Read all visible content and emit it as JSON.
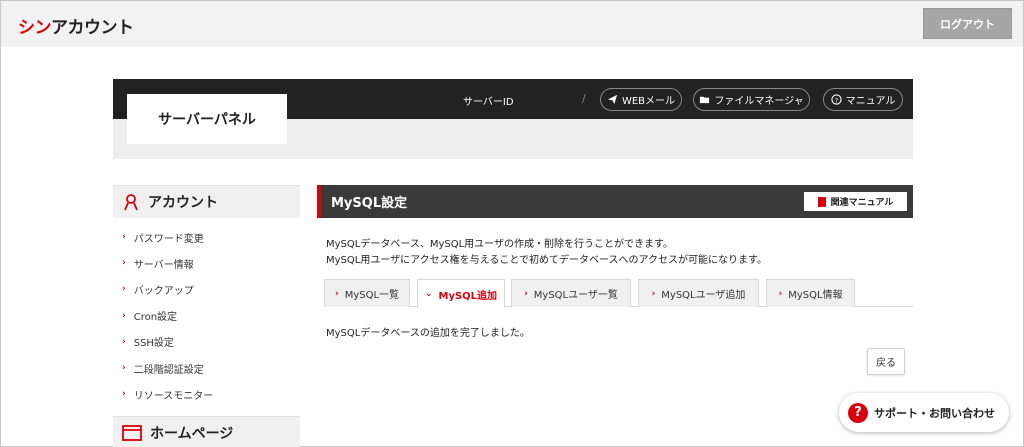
{
  "header": {
    "logo_red": "シン",
    "logo_black": "アカウント",
    "logout_label": "ログアウト"
  },
  "panel": {
    "title": "サーバーパネル",
    "server_id_label": "サーバーID",
    "separator": "/",
    "links": [
      {
        "label": "WEBメール",
        "icon": "paper-plane-icon"
      },
      {
        "label": "ファイルマネージャ",
        "icon": "folder-icon"
      },
      {
        "label": "マニュアル",
        "icon": "question-circle-icon"
      }
    ]
  },
  "sidebar": {
    "section1_title": "アカウント",
    "section1_icon": "person-icon",
    "items": [
      {
        "label": "パスワード変更"
      },
      {
        "label": "サーバー情報"
      },
      {
        "label": "バックアップ"
      },
      {
        "label": "Cron設定"
      },
      {
        "label": "SSH設定"
      },
      {
        "label": "二段階認証設定"
      },
      {
        "label": "リソースモニター"
      }
    ],
    "section2_title": "ホームページ",
    "section2_icon": "browser-window-icon"
  },
  "main": {
    "title": "MySQL設定",
    "manual_button": "関連マニュアル",
    "desc_line1": "MySQLデータベース、MySQL用ユーザの作成・削除を行うことができます。",
    "desc_line2": "MySQL用ユーザにアクセス権を与えることで初めてデータベースへのアクセスが可能になります。",
    "tabs": [
      {
        "label": "MySQL一覧"
      },
      {
        "label": "MySQL追加"
      },
      {
        "label": "MySQLユーザ一覧"
      },
      {
        "label": "MySQLユーザ追加"
      },
      {
        "label": "MySQL情報"
      }
    ],
    "active_tab": "MySQL追加",
    "result_message": "MySQLデータベースの追加を完了しました。",
    "back_button": "戻る"
  },
  "support": {
    "label": "サポート・お問い合わせ"
  },
  "colors": {
    "accent": "#d9000d",
    "dark": "#222222",
    "main_head": "#3a3a3a"
  }
}
